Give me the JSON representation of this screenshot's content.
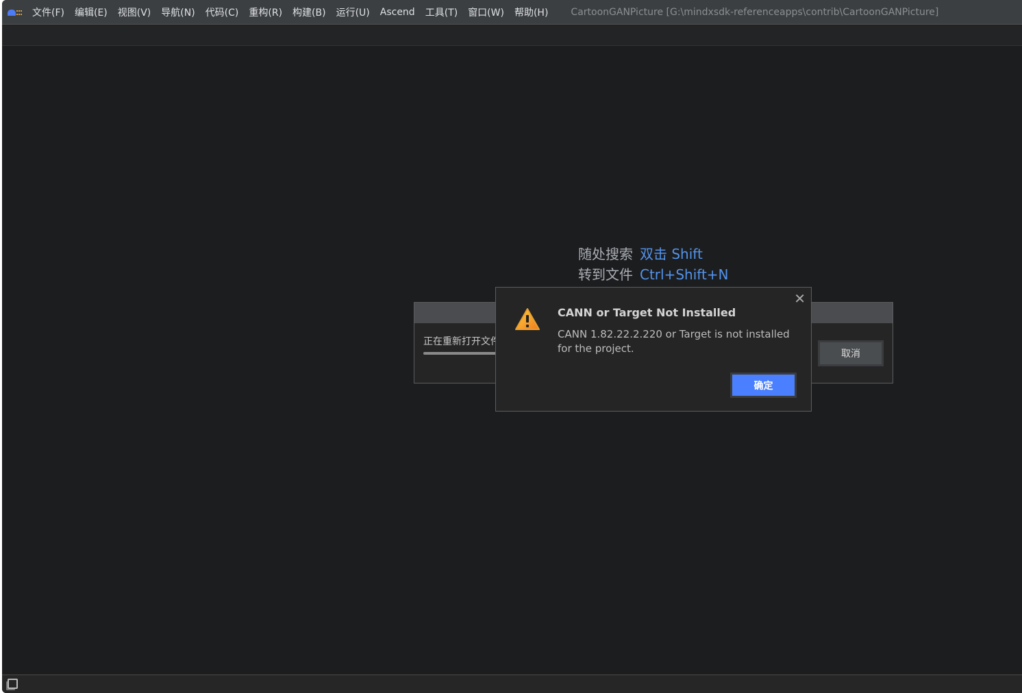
{
  "menubar": {
    "items": [
      "文件(F)",
      "编辑(E)",
      "视图(V)",
      "导航(N)",
      "代码(C)",
      "重构(R)",
      "构建(B)",
      "运行(U)",
      "Ascend",
      "工具(T)",
      "窗口(W)",
      "帮助(H)"
    ],
    "title": "CartoonGANPicture [G:\\mindxsdk-referenceapps\\contrib\\CartoonGANPicture]"
  },
  "hints": [
    {
      "label": "随处搜索",
      "key": "双击 Shift"
    },
    {
      "label": "转到文件",
      "key": "Ctrl+Shift+N"
    }
  ],
  "progress": {
    "message": "正在重新打开文件...",
    "cancel": "取消"
  },
  "dialog": {
    "title": "CANN or Target Not Installed",
    "message": "CANN 1.82.22.2.220 or Target is not installed for the project.",
    "ok": "确定",
    "icon": "warning-icon"
  },
  "colors": {
    "accent": "#4a80ff",
    "link": "#5394ec",
    "background": "#1c1d1f"
  }
}
